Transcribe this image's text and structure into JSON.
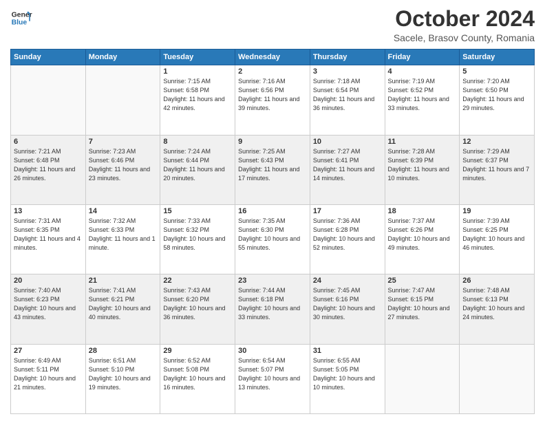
{
  "header": {
    "logo_line1": "General",
    "logo_line2": "Blue",
    "month": "October 2024",
    "location": "Sacele, Brasov County, Romania"
  },
  "weekdays": [
    "Sunday",
    "Monday",
    "Tuesday",
    "Wednesday",
    "Thursday",
    "Friday",
    "Saturday"
  ],
  "weeks": [
    [
      {
        "day": "",
        "info": ""
      },
      {
        "day": "",
        "info": ""
      },
      {
        "day": "1",
        "info": "Sunrise: 7:15 AM\nSunset: 6:58 PM\nDaylight: 11 hours and 42 minutes."
      },
      {
        "day": "2",
        "info": "Sunrise: 7:16 AM\nSunset: 6:56 PM\nDaylight: 11 hours and 39 minutes."
      },
      {
        "day": "3",
        "info": "Sunrise: 7:18 AM\nSunset: 6:54 PM\nDaylight: 11 hours and 36 minutes."
      },
      {
        "day": "4",
        "info": "Sunrise: 7:19 AM\nSunset: 6:52 PM\nDaylight: 11 hours and 33 minutes."
      },
      {
        "day": "5",
        "info": "Sunrise: 7:20 AM\nSunset: 6:50 PM\nDaylight: 11 hours and 29 minutes."
      }
    ],
    [
      {
        "day": "6",
        "info": "Sunrise: 7:21 AM\nSunset: 6:48 PM\nDaylight: 11 hours and 26 minutes."
      },
      {
        "day": "7",
        "info": "Sunrise: 7:23 AM\nSunset: 6:46 PM\nDaylight: 11 hours and 23 minutes."
      },
      {
        "day": "8",
        "info": "Sunrise: 7:24 AM\nSunset: 6:44 PM\nDaylight: 11 hours and 20 minutes."
      },
      {
        "day": "9",
        "info": "Sunrise: 7:25 AM\nSunset: 6:43 PM\nDaylight: 11 hours and 17 minutes."
      },
      {
        "day": "10",
        "info": "Sunrise: 7:27 AM\nSunset: 6:41 PM\nDaylight: 11 hours and 14 minutes."
      },
      {
        "day": "11",
        "info": "Sunrise: 7:28 AM\nSunset: 6:39 PM\nDaylight: 11 hours and 10 minutes."
      },
      {
        "day": "12",
        "info": "Sunrise: 7:29 AM\nSunset: 6:37 PM\nDaylight: 11 hours and 7 minutes."
      }
    ],
    [
      {
        "day": "13",
        "info": "Sunrise: 7:31 AM\nSunset: 6:35 PM\nDaylight: 11 hours and 4 minutes."
      },
      {
        "day": "14",
        "info": "Sunrise: 7:32 AM\nSunset: 6:33 PM\nDaylight: 11 hours and 1 minute."
      },
      {
        "day": "15",
        "info": "Sunrise: 7:33 AM\nSunset: 6:32 PM\nDaylight: 10 hours and 58 minutes."
      },
      {
        "day": "16",
        "info": "Sunrise: 7:35 AM\nSunset: 6:30 PM\nDaylight: 10 hours and 55 minutes."
      },
      {
        "day": "17",
        "info": "Sunrise: 7:36 AM\nSunset: 6:28 PM\nDaylight: 10 hours and 52 minutes."
      },
      {
        "day": "18",
        "info": "Sunrise: 7:37 AM\nSunset: 6:26 PM\nDaylight: 10 hours and 49 minutes."
      },
      {
        "day": "19",
        "info": "Sunrise: 7:39 AM\nSunset: 6:25 PM\nDaylight: 10 hours and 46 minutes."
      }
    ],
    [
      {
        "day": "20",
        "info": "Sunrise: 7:40 AM\nSunset: 6:23 PM\nDaylight: 10 hours and 43 minutes."
      },
      {
        "day": "21",
        "info": "Sunrise: 7:41 AM\nSunset: 6:21 PM\nDaylight: 10 hours and 40 minutes."
      },
      {
        "day": "22",
        "info": "Sunrise: 7:43 AM\nSunset: 6:20 PM\nDaylight: 10 hours and 36 minutes."
      },
      {
        "day": "23",
        "info": "Sunrise: 7:44 AM\nSunset: 6:18 PM\nDaylight: 10 hours and 33 minutes."
      },
      {
        "day": "24",
        "info": "Sunrise: 7:45 AM\nSunset: 6:16 PM\nDaylight: 10 hours and 30 minutes."
      },
      {
        "day": "25",
        "info": "Sunrise: 7:47 AM\nSunset: 6:15 PM\nDaylight: 10 hours and 27 minutes."
      },
      {
        "day": "26",
        "info": "Sunrise: 7:48 AM\nSunset: 6:13 PM\nDaylight: 10 hours and 24 minutes."
      }
    ],
    [
      {
        "day": "27",
        "info": "Sunrise: 6:49 AM\nSunset: 5:11 PM\nDaylight: 10 hours and 21 minutes."
      },
      {
        "day": "28",
        "info": "Sunrise: 6:51 AM\nSunset: 5:10 PM\nDaylight: 10 hours and 19 minutes."
      },
      {
        "day": "29",
        "info": "Sunrise: 6:52 AM\nSunset: 5:08 PM\nDaylight: 10 hours and 16 minutes."
      },
      {
        "day": "30",
        "info": "Sunrise: 6:54 AM\nSunset: 5:07 PM\nDaylight: 10 hours and 13 minutes."
      },
      {
        "day": "31",
        "info": "Sunrise: 6:55 AM\nSunset: 5:05 PM\nDaylight: 10 hours and 10 minutes."
      },
      {
        "day": "",
        "info": ""
      },
      {
        "day": "",
        "info": ""
      }
    ]
  ],
  "row_shading": [
    false,
    true,
    false,
    true,
    false
  ]
}
